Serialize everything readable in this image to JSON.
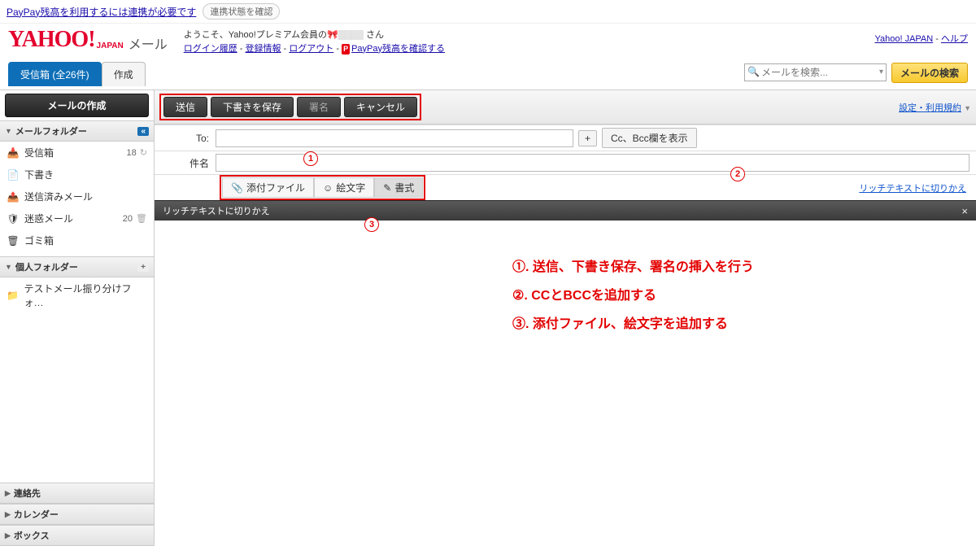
{
  "topbar": {
    "paypay_notice": "PayPay残高を利用するには連携が必要です",
    "check_link": "連携状態を確認"
  },
  "header": {
    "logo_main": "YAHOO!",
    "logo_sub": "JAPAN",
    "mail": "メール",
    "greeting_prefix": "ようこそ、Yahoo!プレミアム会員の",
    "greeting_suffix": " さん",
    "links": {
      "login_history": "ログイン履歴",
      "reg_info": "登録情報",
      "logout": "ログアウト",
      "paypay": "PayPay残高を確認する"
    },
    "right": {
      "yj": "Yahoo! JAPAN",
      "help": "ヘルプ"
    }
  },
  "tabs": {
    "inbox": "受信箱 (全26件)",
    "compose": "作成"
  },
  "search": {
    "placeholder": "メールを検索...",
    "button": "メールの検索"
  },
  "sidebar": {
    "compose": "メールの作成",
    "folders_head": "メールフォルダー",
    "items": [
      {
        "icon": "📥",
        "label": "受信箱",
        "count": "18"
      },
      {
        "icon": "📄",
        "label": "下書き",
        "count": ""
      },
      {
        "icon": "📤",
        "label": "送信済みメール",
        "count": ""
      },
      {
        "icon": "🛡",
        "label": "迷惑メール",
        "count": "20"
      },
      {
        "icon": "🗑",
        "label": "ゴミ箱",
        "count": ""
      }
    ],
    "personal_head": "個人フォルダー",
    "personal_item": "テストメール振り分けフォ…",
    "bottom": [
      "連絡先",
      "カレンダー",
      "ボックス"
    ]
  },
  "toolbar": {
    "send": "送信",
    "draft": "下書きを保存",
    "sign": "署名",
    "cancel": "キャンセル",
    "settings": "設定・利用規約"
  },
  "fields": {
    "to_label": "To:",
    "subject_label": "件名",
    "plus": "+",
    "cc_bcc": "Cc、Bcc欄を表示",
    "attach": "添付ファイル",
    "emoji": "絵文字",
    "format": "書式",
    "rich_switch": "リッチテキストに切りかえ"
  },
  "richbar": {
    "text": "リッチテキストに切りかえ"
  },
  "annotations": {
    "l1": "①. 送信、下書き保存、署名の挿入を行う",
    "l2": "②. CCとBCCを追加する",
    "l3": "③. 添付ファイル、絵文字を追加する",
    "c1": "1",
    "c2": "2",
    "c3": "3"
  }
}
